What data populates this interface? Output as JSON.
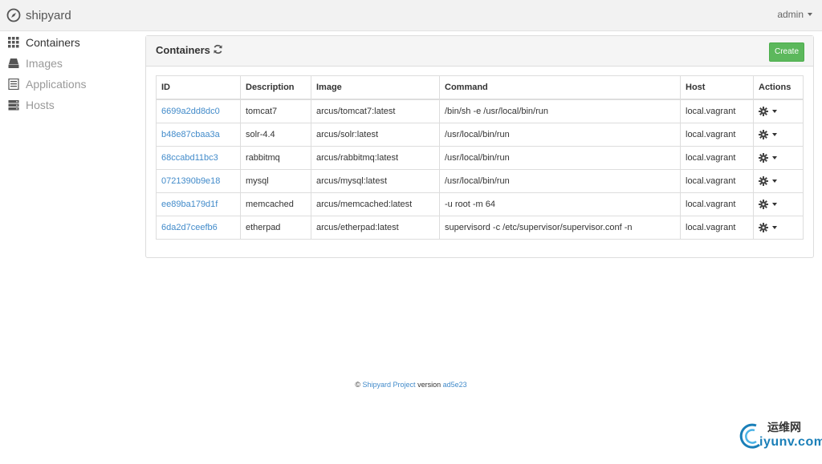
{
  "app": {
    "name": "shipyard",
    "user": "admin"
  },
  "sidebar": {
    "items": [
      {
        "label": "Containers",
        "icon": "grid-icon",
        "active": true
      },
      {
        "label": "Images",
        "icon": "drive-icon"
      },
      {
        "label": "Applications",
        "icon": "list-icon"
      },
      {
        "label": "Hosts",
        "icon": "server-icon"
      }
    ]
  },
  "panel": {
    "title": "Containers",
    "create_label": "Create"
  },
  "table": {
    "headers": [
      "ID",
      "Description",
      "Image",
      "Command",
      "Host",
      "Actions"
    ],
    "rows": [
      {
        "id": "6699a2dd8dc0",
        "description": "tomcat7",
        "image": "arcus/tomcat7:latest",
        "command": "/bin/sh -e /usr/local/bin/run",
        "host": "local.vagrant"
      },
      {
        "id": "b48e87cbaa3a",
        "description": "solr-4.4",
        "image": "arcus/solr:latest",
        "command": "/usr/local/bin/run",
        "host": "local.vagrant"
      },
      {
        "id": "68ccabd11bc3",
        "description": "rabbitmq",
        "image": "arcus/rabbitmq:latest",
        "command": "/usr/local/bin/run",
        "host": "local.vagrant"
      },
      {
        "id": "0721390b9e18",
        "description": "mysql",
        "image": "arcus/mysql:latest",
        "command": "/usr/local/bin/run",
        "host": "local.vagrant"
      },
      {
        "id": "ee89ba179d1f",
        "description": "memcached",
        "image": "arcus/memcached:latest",
        "command": "-u root -m 64",
        "host": "local.vagrant"
      },
      {
        "id": "6da2d7ceefb6",
        "description": "etherpad",
        "image": "arcus/etherpad:latest",
        "command": "supervisord -c /etc/supervisor/supervisor.conf -n",
        "host": "local.vagrant"
      }
    ]
  },
  "footer": {
    "copyright": "©",
    "project_link": "Shipyard Project",
    "version_label": "version",
    "version": "ad5e23"
  },
  "watermark": {
    "cn": "运维网",
    "url": "iyunv.com"
  },
  "colors": {
    "link": "#428bca",
    "create": "#5cb85c",
    "navbar": "#f2f2f2"
  }
}
